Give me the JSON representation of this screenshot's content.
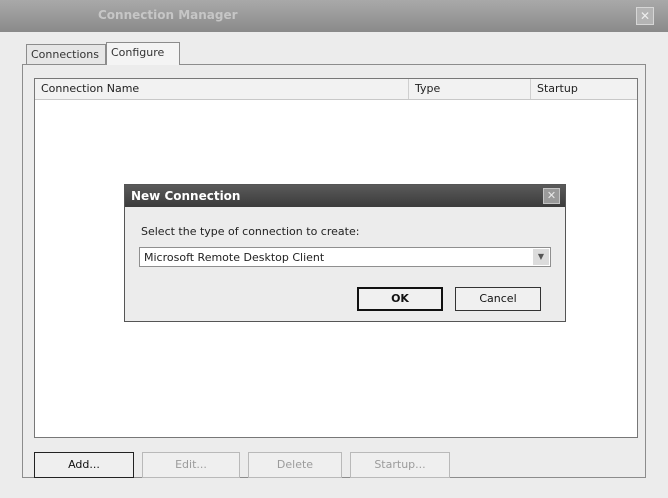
{
  "window": {
    "title": "Connection Manager",
    "close_glyph": "✕"
  },
  "tabs": [
    {
      "label": "Connections",
      "active": false
    },
    {
      "label": "Configure",
      "active": true
    }
  ],
  "list": {
    "columns": [
      "Connection Name",
      "Type",
      "Startup"
    ]
  },
  "buttons": {
    "add": "Add...",
    "edit": "Edit...",
    "delete": "Delete",
    "startup": "Startup..."
  },
  "dialog": {
    "title": "New Connection",
    "close_glyph": "✕",
    "prompt": "Select the type of connection to create:",
    "selected_type": "Microsoft Remote Desktop Client",
    "ok": "OK",
    "cancel": "Cancel"
  },
  "icons": {
    "dropdown": "chevron-down-icon",
    "close": "close-icon"
  }
}
